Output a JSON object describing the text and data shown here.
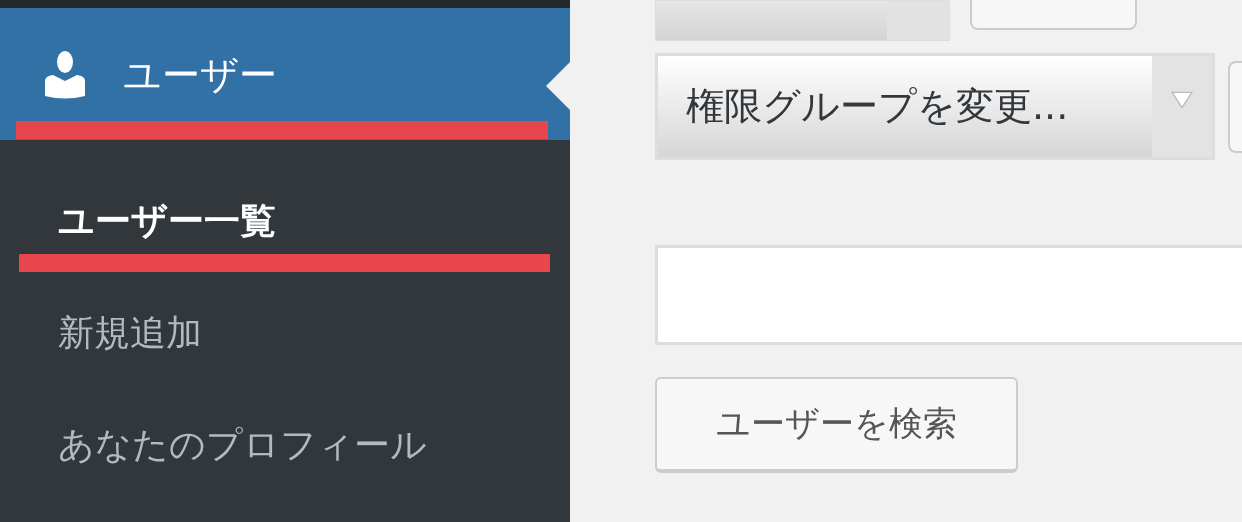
{
  "sidebar": {
    "menu_item": {
      "label": "ユーザー",
      "selected": true,
      "underlined": true
    },
    "submenu": [
      {
        "label": "ユーザー一覧",
        "selected": true,
        "underlined": true
      },
      {
        "label": "新規追加",
        "selected": false,
        "underlined": false
      },
      {
        "label": "あなたのプロフィール",
        "selected": false,
        "underlined": false
      }
    ]
  },
  "main": {
    "role_select": {
      "value": "権限グループを変更..."
    },
    "search_button": {
      "label": "ユーザーを検索"
    }
  }
}
